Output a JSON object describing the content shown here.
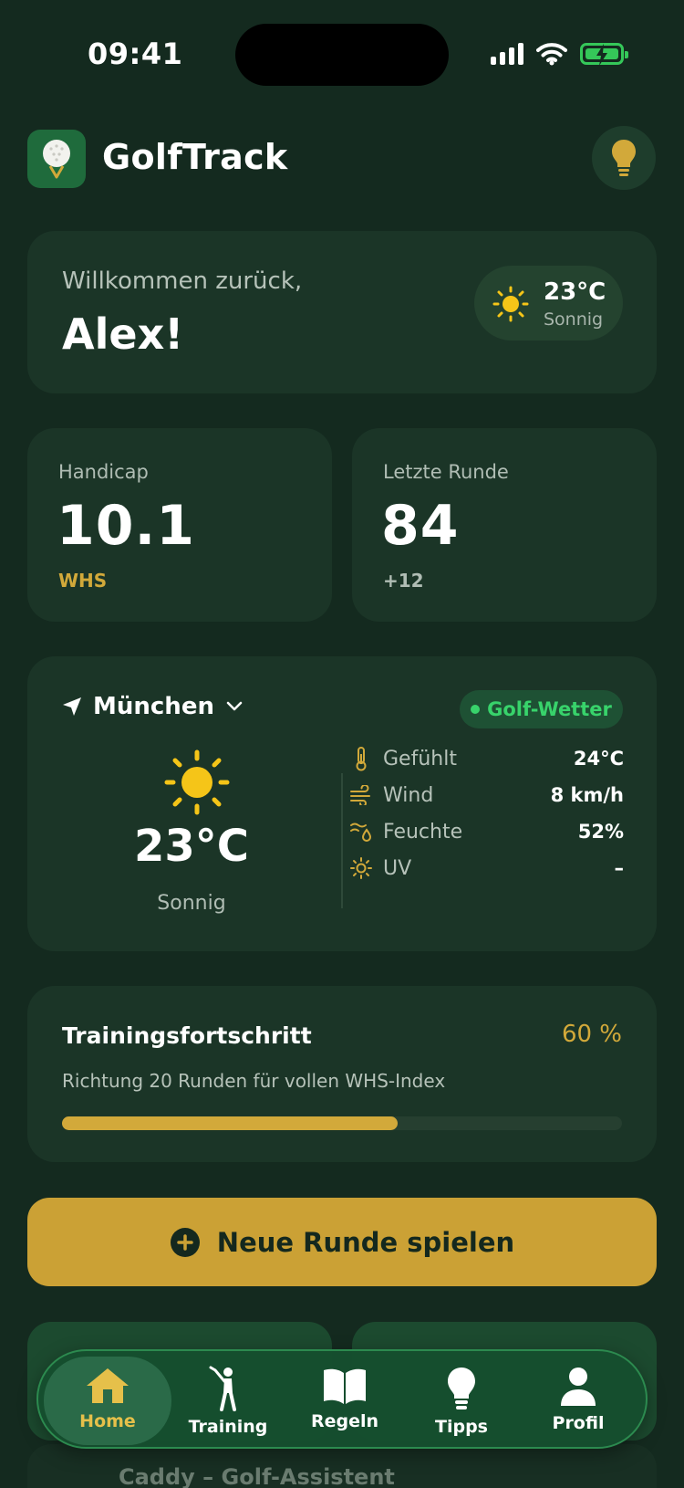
{
  "status_bar": {
    "time": "09:41"
  },
  "header": {
    "app_title": "GolfTrack"
  },
  "welcome": {
    "subtitle": "Willkommen zurück,",
    "name": "Alex!",
    "weather_temp": "23°C",
    "weather_condition": "Sonnig"
  },
  "stats": [
    {
      "label": "Handicap",
      "value": "10.1",
      "sub": "WHS"
    },
    {
      "label": "Letzte Runde",
      "value": "84",
      "sub": "+12"
    }
  ],
  "weather": {
    "city": "München",
    "badge": "Golf-Wetter",
    "temp": "23°C",
    "condition": "Sonnig",
    "details": [
      {
        "icon": "thermometer-icon",
        "label": "Gefühlt",
        "value": "24°C"
      },
      {
        "icon": "wind-icon",
        "label": "Wind",
        "value": "8 km/h"
      },
      {
        "icon": "humidity-icon",
        "label": "Feuchte",
        "value": "52%"
      },
      {
        "icon": "uv-sun-icon",
        "label": "UV",
        "value": "–"
      }
    ]
  },
  "training": {
    "title": "Trainingsfortschritt",
    "percent_label": "60 %",
    "progress": 0.6,
    "subtitle": "Richtung 20 Runden für vollen WHS-Index"
  },
  "cta": {
    "label": "Neue Runde spielen"
  },
  "partial": {
    "text": "Caddy – Golf-Assistent"
  },
  "tabs": [
    {
      "label": "Home",
      "icon": "home-icon",
      "active": true
    },
    {
      "label": "Training",
      "icon": "golfer-icon",
      "active": false
    },
    {
      "label": "Regeln",
      "icon": "book-icon",
      "active": false
    },
    {
      "label": "Tipps",
      "icon": "lightbulb-icon",
      "active": false
    },
    {
      "label": "Profil",
      "icon": "person-icon",
      "active": false
    }
  ],
  "colors": {
    "background": "#142a1f",
    "card": "#1b3527",
    "accent_gold": "#cba135",
    "status_green": "#38d36b",
    "tab_bar": "#164e2e"
  }
}
